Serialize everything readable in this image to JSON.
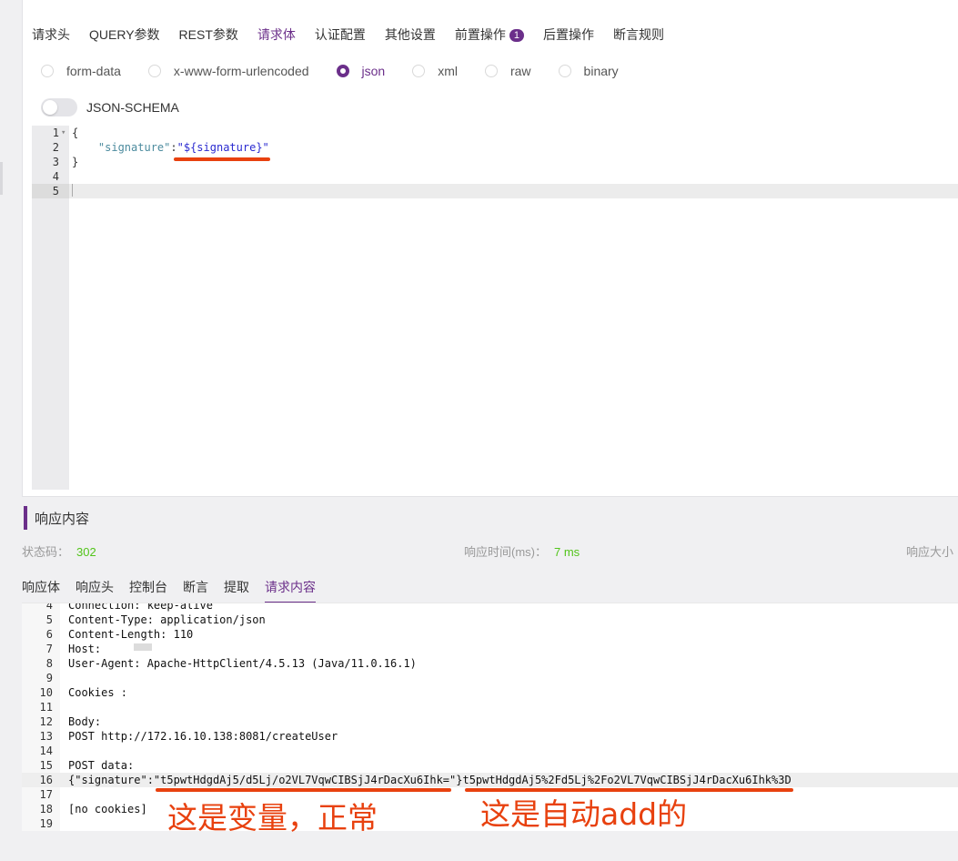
{
  "request_tabs": [
    {
      "label": "请求头"
    },
    {
      "label": "QUERY参数"
    },
    {
      "label": "REST参数"
    },
    {
      "label": "请求体",
      "active": true
    },
    {
      "label": "认证配置"
    },
    {
      "label": "其他设置"
    },
    {
      "label": "前置操作",
      "badge": "1"
    },
    {
      "label": "后置操作"
    },
    {
      "label": "断言规则"
    }
  ],
  "body_types": [
    {
      "label": "form-data",
      "checked": false
    },
    {
      "label": "x-www-form-urlencoded",
      "checked": false
    },
    {
      "label": "json",
      "checked": true
    },
    {
      "label": "xml",
      "checked": false
    },
    {
      "label": "raw",
      "checked": false
    },
    {
      "label": "binary",
      "checked": false
    }
  ],
  "schema_toggle": {
    "label": "JSON-SCHEMA",
    "on": false
  },
  "editor": {
    "lines": [
      {
        "n": "1",
        "text": "{"
      },
      {
        "n": "2",
        "key": "\"signature\"",
        "sep": ":",
        "value": "\"${signature}\""
      },
      {
        "n": "3",
        "text": "}"
      },
      {
        "n": "4",
        "text": ""
      },
      {
        "n": "5",
        "text": ""
      }
    ]
  },
  "response": {
    "title": "响应内容",
    "status_label": "状态码：",
    "status_value": "302",
    "time_label": "响应时间(ms)：",
    "time_value": "7 ms",
    "size_label": "响应大小"
  },
  "response_tabs": [
    {
      "label": "响应体"
    },
    {
      "label": "响应头"
    },
    {
      "label": "控制台"
    },
    {
      "label": "断言"
    },
    {
      "label": "提取"
    },
    {
      "label": "请求内容",
      "active": true
    }
  ],
  "log_lines": [
    {
      "n": "4",
      "text": "Connection: keep-alive"
    },
    {
      "n": "5",
      "text": "Content-Type: application/json"
    },
    {
      "n": "6",
      "text": "Content-Length: 110"
    },
    {
      "n": "7",
      "text": "Host:"
    },
    {
      "n": "8",
      "text": "User-Agent: Apache-HttpClient/4.5.13 (Java/11.0.16.1)"
    },
    {
      "n": "9",
      "text": ""
    },
    {
      "n": "10",
      "text": "Cookies :"
    },
    {
      "n": "11",
      "text": ""
    },
    {
      "n": "12",
      "text": "Body:"
    },
    {
      "n": "13",
      "text": "POST http://172.16.10.138:8081/createUser"
    },
    {
      "n": "14",
      "text": ""
    },
    {
      "n": "15",
      "text": "POST data:"
    },
    {
      "n": "16",
      "text": "{\"signature\":\"t5pwtHdgdAj5/d5Lj/o2VL7VqwCIBSjJ4rDacXu6Ihk=\"}t5pwtHdgdAj5%2Fd5Lj%2Fo2VL7VqwCIBSjJ4rDacXu6Ihk%3D"
    },
    {
      "n": "17",
      "text": ""
    },
    {
      "n": "18",
      "text": "[no cookies]"
    },
    {
      "n": "19",
      "text": ""
    }
  ],
  "annotations": {
    "left": "这是变量，正常",
    "right": "这是自动add的"
  },
  "colors": {
    "accent": "#6b2f8a",
    "success": "#52c41a",
    "annotation": "#e8410f"
  }
}
